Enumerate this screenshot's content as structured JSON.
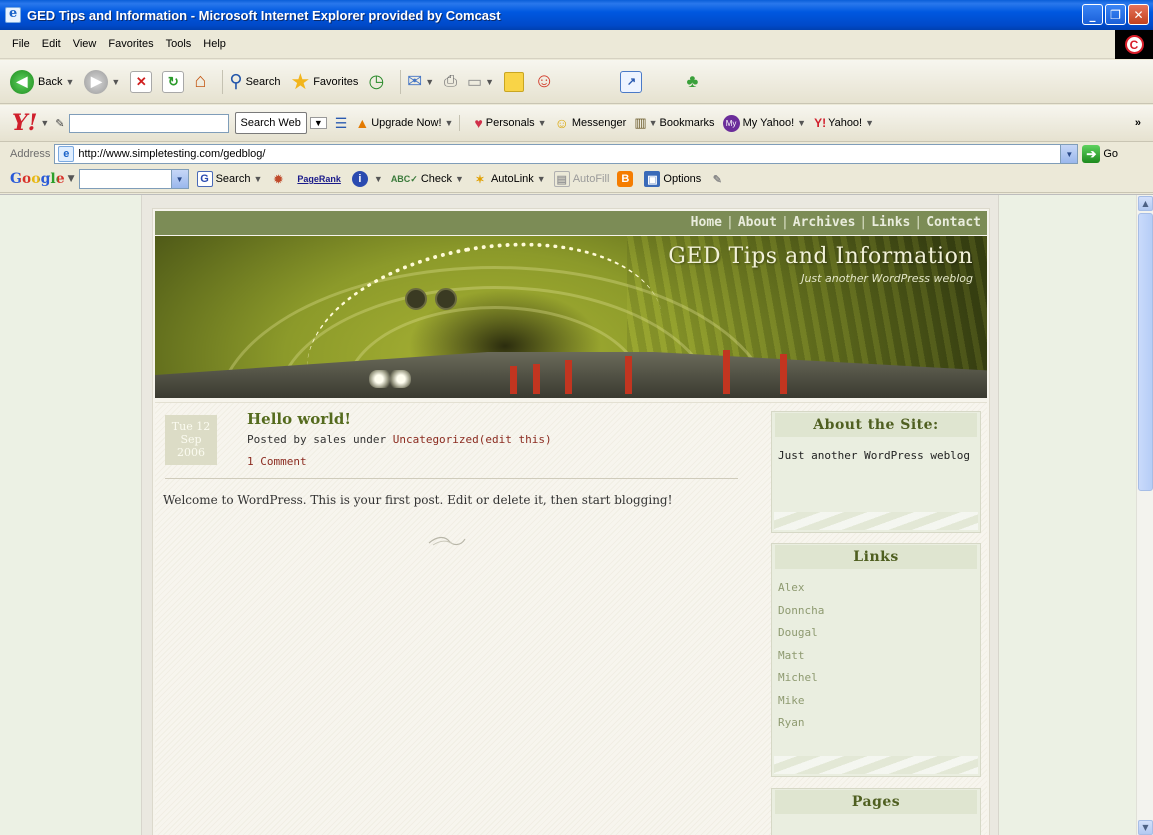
{
  "window": {
    "title": "GED Tips and Information - Microsoft Internet Explorer provided by Comcast",
    "buttons": [
      "minimize",
      "maximize",
      "close"
    ]
  },
  "menu": {
    "items": [
      "File",
      "Edit",
      "View",
      "Favorites",
      "Tools",
      "Help"
    ]
  },
  "toolbar": {
    "back_label": "Back",
    "search_label": "Search",
    "favorites_label": "Favorites"
  },
  "yahoo_toolbar": {
    "search_button": "Search Web",
    "upgrade_label": "Upgrade Now!",
    "personals_label": "Personals",
    "messenger_label": "Messenger",
    "bookmarks_label": "Bookmarks",
    "myyahoo_label": "My Yahoo!",
    "yahoo_label": "Yahoo!",
    "overflow_label": "»"
  },
  "address_bar": {
    "label": "Address",
    "url": "http://www.simpletesting.com/gedblog/",
    "go_label": "Go"
  },
  "google_toolbar": {
    "logo": "Google",
    "search_label": "Search",
    "pagerank_label": "PageRank",
    "check_label": "Check",
    "autolink_label": "AutoLink",
    "autofill_label": "AutoFill",
    "options_label": "Options"
  },
  "blog": {
    "nav": [
      "Home",
      "About",
      "Archives",
      "Links",
      "Contact"
    ],
    "title": "GED Tips and Information",
    "tagline": "Just another WordPress weblog",
    "post": {
      "date_day": "Tue 12",
      "date_month": "Sep",
      "date_year": "2006",
      "title": "Hello world!",
      "meta_prefix": "Posted by sales under ",
      "category": "Uncategorized",
      "edit_link": "(edit this)",
      "comments": "1 Comment",
      "body": "Welcome to WordPress. This is your first post. Edit or delete it, then start blogging!"
    },
    "sidebar": {
      "about": {
        "title": "About the Site:",
        "text": "Just another WordPress weblog"
      },
      "links": {
        "title": "Links",
        "items": [
          "Alex",
          "Donncha",
          "Dougal",
          "Matt",
          "Michel",
          "Mike",
          "Ryan"
        ]
      },
      "pages": {
        "title": "Pages"
      }
    }
  }
}
